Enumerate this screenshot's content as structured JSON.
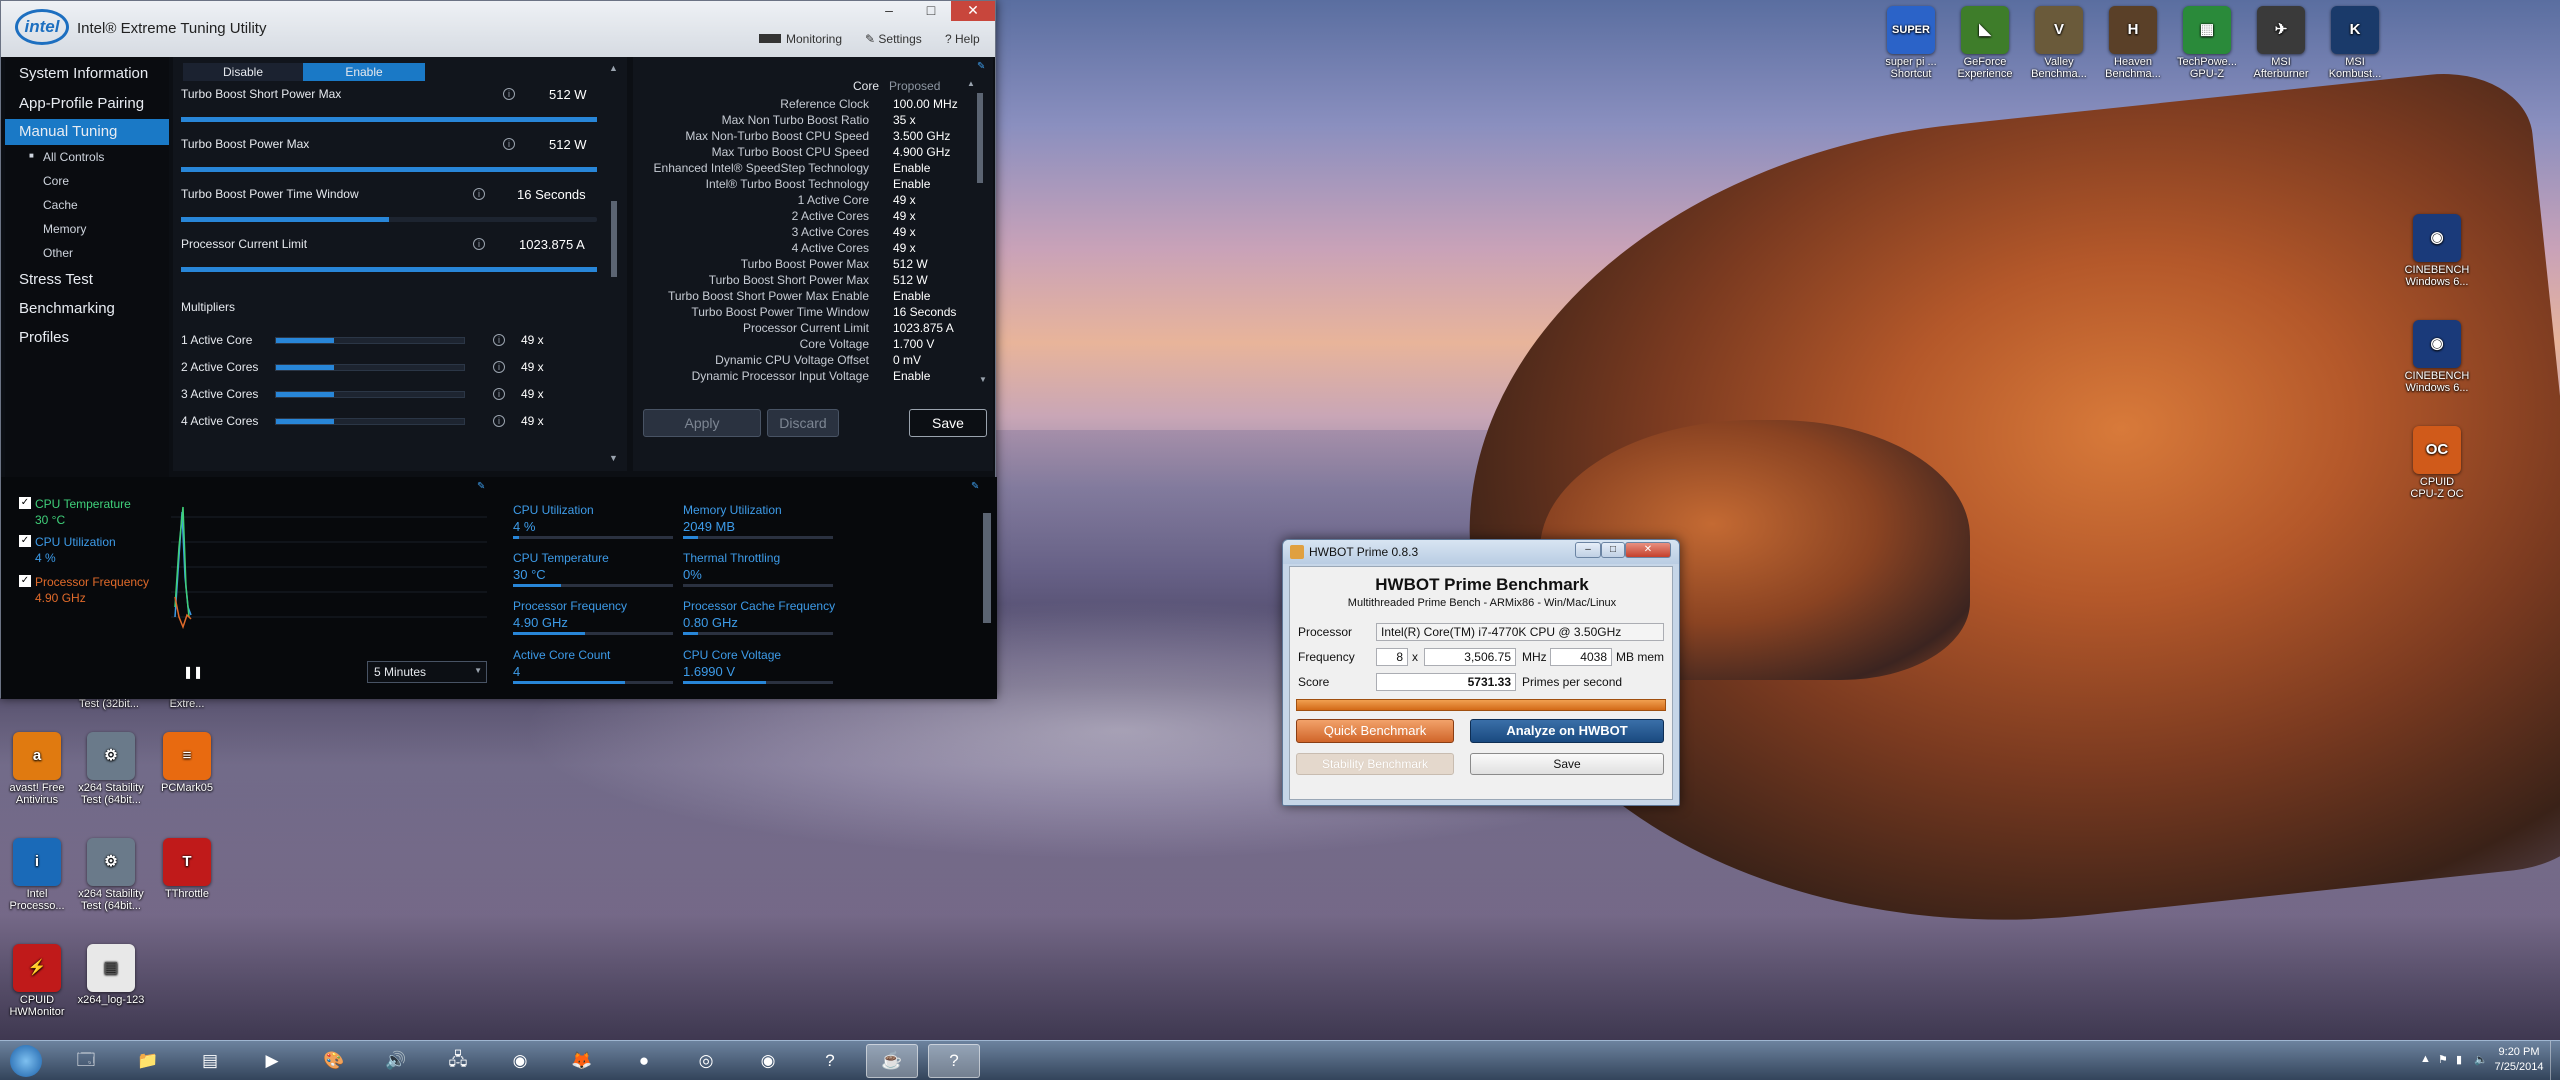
{
  "xtu": {
    "title": "Intel® Extreme Tuning Utility",
    "logo": "intel",
    "menu": {
      "monitoring": "Monitoring",
      "settings": "Settings",
      "help": "Help"
    },
    "nav": {
      "items": [
        "System Information",
        "App-Profile Pairing",
        "Manual Tuning",
        "Stress Test",
        "Benchmarking",
        "Profiles"
      ],
      "sub": [
        "All Controls",
        "Core",
        "Cache",
        "Memory",
        "Other"
      ]
    },
    "toggle": {
      "disable": "Disable",
      "enable": "Enable"
    },
    "rows": [
      {
        "label": "Turbo Boost Short Power Max",
        "value": "512 W",
        "fill": 1.0
      },
      {
        "label": "Turbo Boost Power Max",
        "value": "512 W",
        "fill": 1.0
      },
      {
        "label": "Turbo Boost Power Time Window",
        "value": "16 Seconds",
        "fill": 0.5
      },
      {
        "label": "Processor Current Limit",
        "value": "1023.875 A",
        "fill": 1.0
      }
    ],
    "multipliers_header": "Multipliers",
    "multipliers": [
      {
        "label": "1 Active Core",
        "value": "49 x",
        "fill": 0.31
      },
      {
        "label": "2 Active Cores",
        "value": "49 x",
        "fill": 0.31
      },
      {
        "label": "3 Active Cores",
        "value": "49 x",
        "fill": 0.31
      },
      {
        "label": "4 Active Cores",
        "value": "49 x",
        "fill": 0.31
      }
    ],
    "core_panel": {
      "col_core": "Core",
      "col_proposed": "Proposed",
      "rows": [
        {
          "k": "Reference Clock",
          "v": "100.00 MHz"
        },
        {
          "k": "Max Non Turbo Boost Ratio",
          "v": "35 x"
        },
        {
          "k": "Max Non-Turbo Boost CPU Speed",
          "v": "3.500 GHz"
        },
        {
          "k": "Max Turbo Boost CPU Speed",
          "v": "4.900 GHz"
        },
        {
          "k": "Enhanced Intel® SpeedStep Technology",
          "v": "Enable"
        },
        {
          "k": "Intel® Turbo Boost Technology",
          "v": "Enable"
        },
        {
          "k": "1 Active Core",
          "v": "49 x"
        },
        {
          "k": "2 Active Cores",
          "v": "49 x"
        },
        {
          "k": "3 Active Cores",
          "v": "49 x"
        },
        {
          "k": "4 Active Cores",
          "v": "49 x"
        },
        {
          "k": "Turbo Boost Power Max",
          "v": "512 W"
        },
        {
          "k": "Turbo Boost Short Power Max",
          "v": "512 W"
        },
        {
          "k": "Turbo Boost Short Power Max Enable",
          "v": "Enable"
        },
        {
          "k": "Turbo Boost Power Time Window",
          "v": "16 Seconds"
        },
        {
          "k": "Processor Current Limit",
          "v": "1023.875 A"
        },
        {
          "k": "Core Voltage",
          "v": "1.700 V"
        },
        {
          "k": "Dynamic CPU Voltage Offset",
          "v": "0 mV"
        },
        {
          "k": "Dynamic Processor Input Voltage",
          "v": "Enable"
        }
      ],
      "apply": "Apply",
      "discard": "Discard",
      "save": "Save"
    },
    "monitor": {
      "checks": [
        {
          "label": "CPU Temperature",
          "value": "30 °C",
          "color": "#3fd07a"
        },
        {
          "label": "CPU Utilization",
          "value": "4 %",
          "color": "#3d9be8"
        },
        {
          "label": "Processor Frequency",
          "value": "4.90 GHz",
          "color": "#e06a2a"
        }
      ],
      "duration": "5 Minutes",
      "stats_left": [
        {
          "label": "CPU Utilization",
          "value": "4 %",
          "fill": 0.04
        },
        {
          "label": "CPU Temperature",
          "value": "30 °C",
          "fill": 0.3
        },
        {
          "label": "Processor Frequency",
          "value": "4.90 GHz",
          "fill": 0.45
        },
        {
          "label": "Active Core Count",
          "value": "4",
          "fill": 0.7
        }
      ],
      "stats_right": [
        {
          "label": "Memory Utilization",
          "value": "2049  MB",
          "fill": 0.1
        },
        {
          "label": "Thermal Throttling",
          "value": "0%",
          "fill": 0.0
        },
        {
          "label": "Processor Cache Frequency",
          "value": "0.80 GHz",
          "fill": 0.1
        },
        {
          "label": "CPU Core Voltage",
          "value": "1.6990 V",
          "fill": 0.55
        }
      ]
    }
  },
  "hwbot": {
    "window_title": "HWBOT Prime 0.8.3",
    "heading": "HWBOT Prime Benchmark",
    "subheading": "Multithreaded Prime Bench - ARMix86 - Win/Mac/Linux",
    "processor_label": "Processor",
    "processor_value": "Intel(R) Core(TM) i7-4770K CPU @ 3.50GHz",
    "frequency_label": "Frequency",
    "threads": "8",
    "x": "x",
    "freq_value": "3,506.75",
    "mhz": "MHz",
    "mem_value": "4038",
    "mem_unit": "MB mem",
    "score_label": "Score",
    "score_value": "5731.33",
    "score_unit": "Primes per second",
    "quick": "Quick Benchmark",
    "analyze": "Analyze on HWBOT",
    "stability": "Stability Benchmark",
    "save": "Save"
  },
  "desktop_icons": [
    {
      "label": "super pi ...\nShortcut",
      "glyph": "SUPER",
      "color": "#2b63c8"
    },
    {
      "label": "GeForce\nExperience",
      "glyph": "◣",
      "color": "#3e7d2a"
    },
    {
      "label": "Valley\nBenchma...",
      "glyph": "V",
      "color": "#6a5a3a"
    },
    {
      "label": "Heaven\nBenchma...",
      "glyph": "H",
      "color": "#5a4028"
    },
    {
      "label": "TechPowe...\nGPU-Z",
      "glyph": "▦",
      "color": "#2a8a3a"
    },
    {
      "label": "MSI\nAfterburner",
      "glyph": "✈",
      "color": "#3a3a3a"
    },
    {
      "label": "MSI\nKombust...",
      "glyph": "K",
      "color": "#1a3a6a"
    },
    {
      "label": "CINEBENCH\nWindows 6...",
      "glyph": "◉",
      "color": "#1a3a7a"
    },
    {
      "label": "CINEBENCH\nWindows 6...",
      "glyph": "◉",
      "color": "#1a3a7a"
    },
    {
      "label": "CPUID\nCPU-Z OC",
      "glyph": "OC",
      "color": "#d05a1a"
    },
    {
      "label": "Test (32bit...",
      "glyph": "",
      "color": "#000"
    },
    {
      "label": "Extre...",
      "glyph": "",
      "color": "#000"
    },
    {
      "label": "avast! Free\nAntivirus",
      "glyph": "a",
      "color": "#e07a10"
    },
    {
      "label": "x264 Stability\nTest (64bit...",
      "glyph": "⚙",
      "color": "#6a7a8a"
    },
    {
      "label": "PCMark05",
      "glyph": "≡",
      "color": "#e86a10"
    },
    {
      "label": "Intel\nProcesso...",
      "glyph": "i",
      "color": "#1a6ab8"
    },
    {
      "label": "x264 Stability\nTest (64bit...",
      "glyph": "⚙",
      "color": "#6a7a8a"
    },
    {
      "label": "TThrottle",
      "glyph": "T",
      "color": "#c01a1a"
    },
    {
      "label": "CPUID\nHWMonitor",
      "glyph": "⚡",
      "color": "#c01a1a"
    },
    {
      "label": "x264_log-123",
      "glyph": "▤",
      "color": "#e8e8e8"
    }
  ],
  "taskbar": {
    "items": [
      "start-orb",
      "explorer",
      "folder",
      "notepad",
      "media",
      "paint",
      "speaker",
      "network-tool",
      "chrome",
      "firefox",
      "orb-app",
      "cinebench",
      "cinebench-2",
      "help-app",
      "java-app",
      "help-app-2"
    ],
    "time": "9:20 PM",
    "date": "7/25/2014"
  }
}
